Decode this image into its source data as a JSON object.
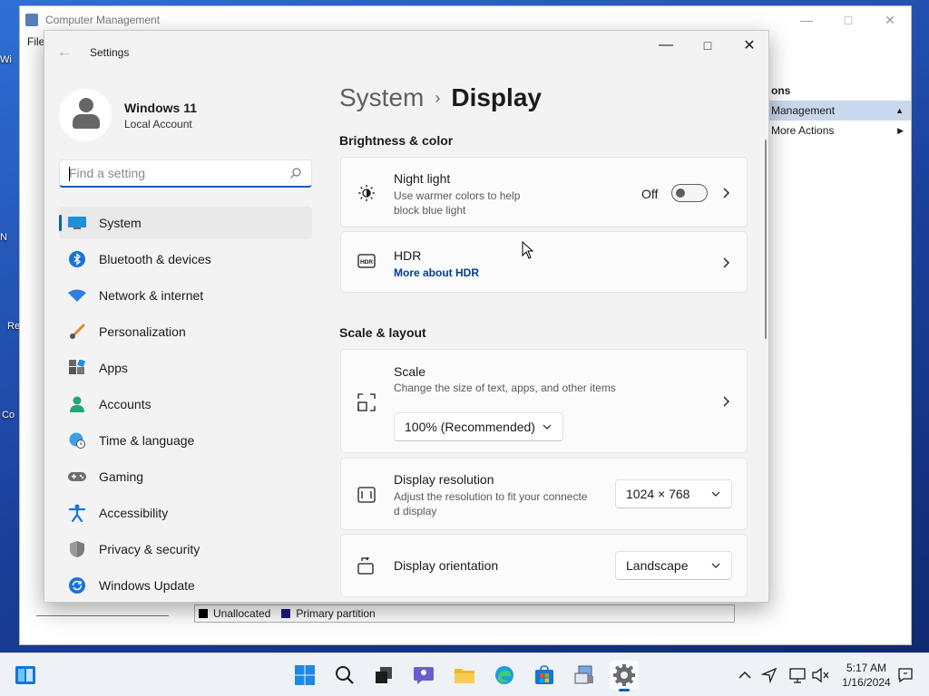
{
  "background_window": {
    "title": "Computer Management",
    "menu_file": "File",
    "actions_header": "ons",
    "actions_selected": "Management",
    "actions_more": "More Actions",
    "legend": [
      {
        "label": "Unallocated",
        "color": "#000000"
      },
      {
        "label": "Primary partition",
        "color": "#1a1a8c"
      }
    ]
  },
  "desktop_icons": [
    "Wi",
    "N",
    "Re",
    "Co"
  ],
  "settings": {
    "window_title": "Settings",
    "profile": {
      "name": "Windows 11",
      "account_type": "Local Account"
    },
    "search": {
      "placeholder": "Find a setting"
    },
    "nav": [
      {
        "label": "System",
        "icon": "system-icon",
        "active": true
      },
      {
        "label": "Bluetooth & devices",
        "icon": "bluetooth-icon"
      },
      {
        "label": "Network & internet",
        "icon": "network-icon"
      },
      {
        "label": "Personalization",
        "icon": "brush-icon"
      },
      {
        "label": "Apps",
        "icon": "apps-icon"
      },
      {
        "label": "Accounts",
        "icon": "accounts-icon"
      },
      {
        "label": "Time & language",
        "icon": "globe-clock-icon"
      },
      {
        "label": "Gaming",
        "icon": "gamepad-icon"
      },
      {
        "label": "Accessibility",
        "icon": "accessibility-icon"
      },
      {
        "label": "Privacy & security",
        "icon": "shield-icon"
      },
      {
        "label": "Windows Update",
        "icon": "update-icon"
      }
    ],
    "breadcrumb": {
      "parent": "System",
      "separator": "›",
      "current": "Display"
    },
    "sections": {
      "brightness": {
        "title": "Brightness & color",
        "night_light": {
          "title": "Night light",
          "desc_line1": "Use warmer colors to help",
          "desc_line2": "block blue light",
          "state": "Off"
        },
        "hdr": {
          "title": "HDR",
          "link": "More about HDR"
        }
      },
      "scale_layout": {
        "title": "Scale & layout",
        "scale": {
          "title": "Scale",
          "desc": "Change the size of text, apps, and other items",
          "value": "100% (Recommended)"
        },
        "resolution": {
          "title": "Display resolution",
          "desc_line1": "Adjust the resolution to fit your connecte",
          "desc_line2": "d display",
          "value": "1024 × 768"
        },
        "orientation": {
          "title": "Display orientation",
          "value": "Landscape"
        }
      }
    }
  },
  "taskbar": {
    "time": "5:17 AM",
    "date": "1/16/2024"
  },
  "colors": {
    "accent": "#005fb8",
    "link": "#003e92"
  }
}
